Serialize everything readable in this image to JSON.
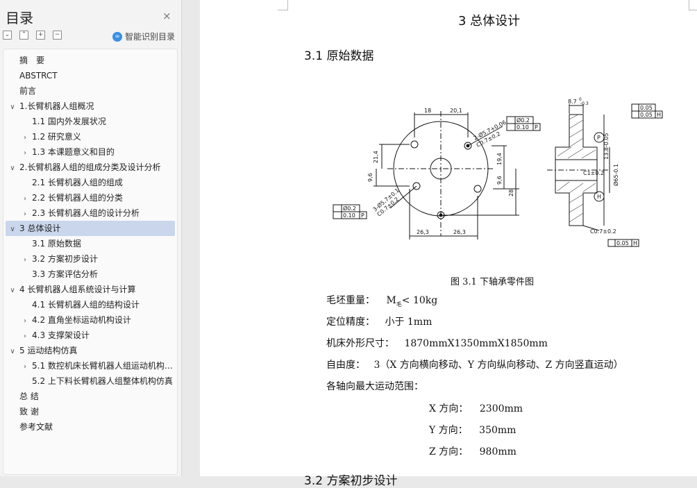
{
  "sidebar": {
    "title": "目录",
    "close": "×",
    "toolbar": [
      "⌄",
      "⌃",
      "+",
      "−"
    ],
    "smart_label": "智能识别目录",
    "items": [
      {
        "label": "摘　要",
        "level": 0,
        "chev": ""
      },
      {
        "label": "ABSTRCT",
        "level": 0,
        "chev": ""
      },
      {
        "label": "前言",
        "level": 0,
        "chev": ""
      },
      {
        "label": "1.长臂机器人组概况",
        "level": 0,
        "chev": "∨"
      },
      {
        "label": "1.1 国内外发展状况",
        "level": 1,
        "chev": ""
      },
      {
        "label": "1.2 研究意义",
        "level": 1,
        "chev": "›"
      },
      {
        "label": "1.3 本课题意义和目的",
        "level": 1,
        "chev": "›"
      },
      {
        "label": "2.长臂机器人组的组成分类及设计分析",
        "level": 0,
        "chev": "∨"
      },
      {
        "label": "2.1 长臂机器人组的组成",
        "level": 1,
        "chev": ""
      },
      {
        "label": "2.2 长臂机器人组的分类",
        "level": 1,
        "chev": "›"
      },
      {
        "label": "2.3 长臂机器人组的设计分析",
        "level": 1,
        "chev": "›"
      },
      {
        "label": "3 总体设计",
        "level": 0,
        "chev": "∨",
        "active": true
      },
      {
        "label": "3.1 原始数据",
        "level": 1,
        "chev": ""
      },
      {
        "label": "3.2 方案初步设计",
        "level": 1,
        "chev": "›"
      },
      {
        "label": "3.3 方案评估分析",
        "level": 1,
        "chev": ""
      },
      {
        "label": "4 长臂机器人组系统设计与计算",
        "level": 0,
        "chev": "∨"
      },
      {
        "label": "4.1 长臂机器人组的结构设计",
        "level": 1,
        "chev": ""
      },
      {
        "label": "4.2 直角坐标运动机构设计",
        "level": 1,
        "chev": "›"
      },
      {
        "label": "4.3 支撑架设计",
        "level": 1,
        "chev": "›"
      },
      {
        "label": "5 运动结构仿真",
        "level": 0,
        "chev": "∨"
      },
      {
        "label": "5.1 数控机床长臂机器人组运动机构仿真",
        "level": 1,
        "chev": "›"
      },
      {
        "label": "5.2 上下料长臂机器人组整体机构仿真",
        "level": 1,
        "chev": ""
      },
      {
        "label": "总 结",
        "level": 0,
        "chev": ""
      },
      {
        "label": "致 谢",
        "level": 0,
        "chev": ""
      },
      {
        "label": "参考文献",
        "level": 0,
        "chev": ""
      }
    ]
  },
  "doc": {
    "chapter_title": "3  总体设计",
    "section_title": "3.1  原始数据",
    "figure_caption": "图 3.1  下轴承零件图",
    "lines": [
      {
        "label": "毛坯重量：",
        "value_pre": "M",
        "value_sub": "毛",
        "value_post": "< 10kg"
      },
      {
        "label": "定位精度：",
        "value": "小于 1mm"
      },
      {
        "label": "机床外形尺寸：",
        "value": "1870mmX1350mmX1850mm"
      },
      {
        "label": "自由度：",
        "value": "3（X 方向横向移动、Y 方向纵向移动、Z 方向竖直运动）"
      },
      {
        "label": "各轴向最大运动范围：",
        "value": ""
      }
    ],
    "ranges": [
      {
        "axis": "X 方向：",
        "value": "2300mm"
      },
      {
        "axis": "Y 方向：",
        "value": "350mm"
      },
      {
        "axis": "Z 方向：",
        "value": "980mm"
      }
    ],
    "next_section": "3.2  方案初步设计"
  },
  "drawing": {
    "dims": {
      "top_18": "18",
      "top_20_1": "20,1",
      "bot_26_3_a": "26,3",
      "bot_26_3_b": "26,3",
      "left_21_4": "21,4",
      "left_9_6": "9,6",
      "right_19_4": "19,4",
      "right_9_6": "9,6",
      "right_28": "28",
      "hole_note_1": "2-Ø5.7+0.06",
      "hole_note_2": "C0.7±0.2",
      "hole_note_3": "3-Ø5.7±0.1",
      "hole_note_4": "C0.7±0.2",
      "tol_pos": "Ø0.2",
      "tol_flat": "0.10",
      "tol_ref": "P",
      "side_top": "8.7",
      "side_sup": "0",
      "side_sub": "-0.3",
      "side_tol_1": "0.05",
      "side_tol_2": "0.05",
      "side_ref_h": "H",
      "side_ref_p": "P",
      "side_c1": "C1±0.2",
      "side_dia": "Ø65-0.1",
      "side_dim_v": "13.8-0.05",
      "side_c07": "C0.7±0.2",
      "side_bot_tol": "0.05",
      "side_bot_ref": "H"
    }
  }
}
